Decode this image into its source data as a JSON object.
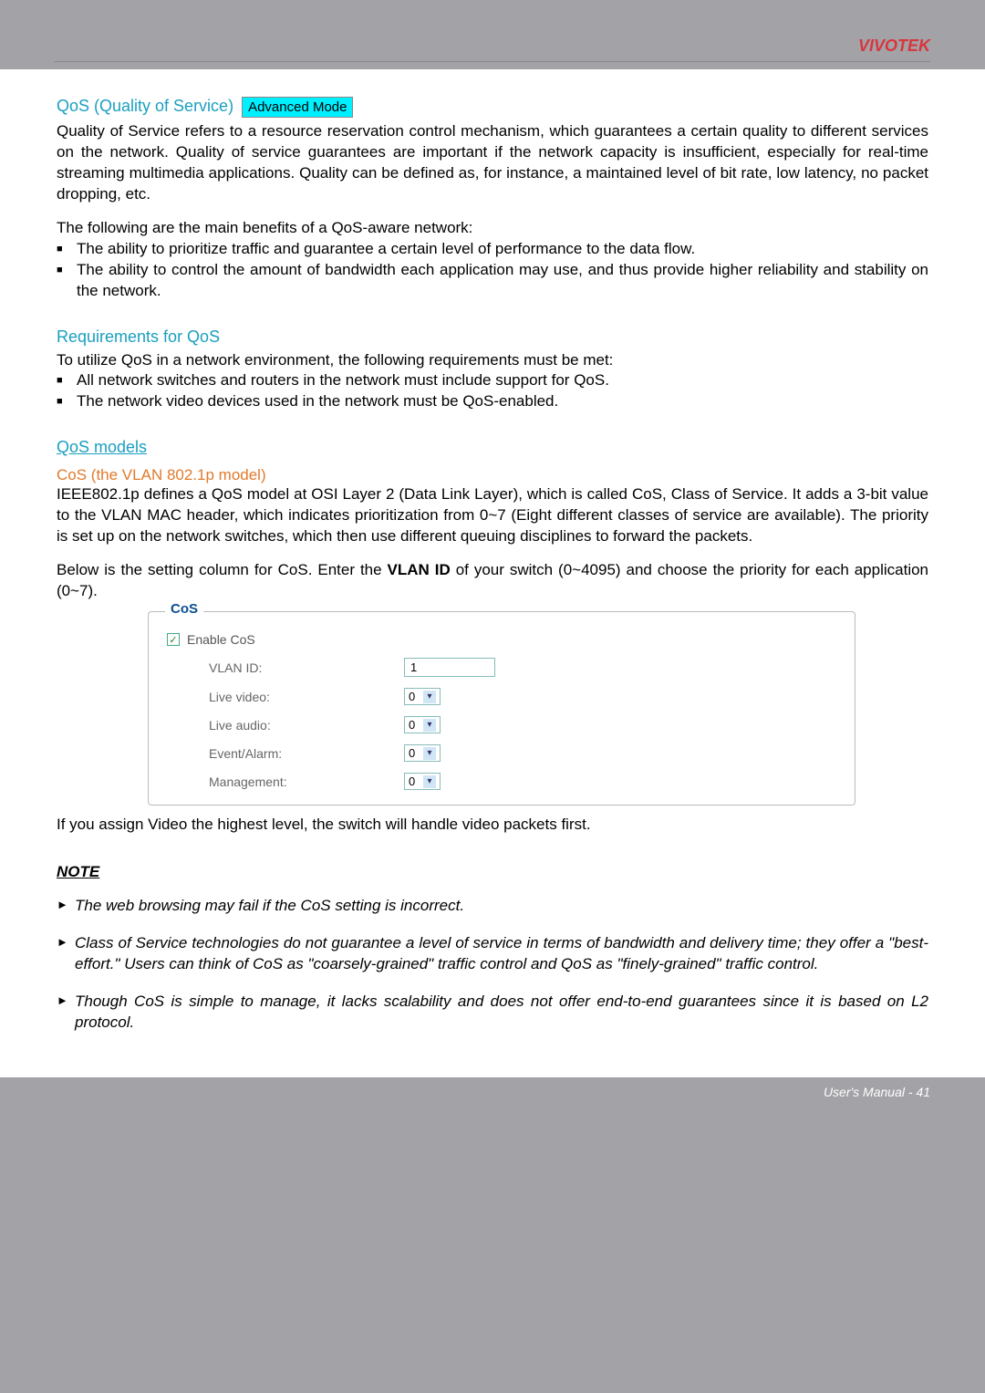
{
  "brand": "VIVOTEK",
  "qos": {
    "title": "QoS (Quality of Service)",
    "badge": "Advanced Mode",
    "intro": "Quality of Service refers to a resource reservation control mechanism, which guarantees a certain quality to different services on the network. Quality of service guarantees are important if the network capacity is insufficient, especially for real-time streaming multimedia applications. Quality can be defined as, for instance, a maintained level of bit rate, low latency, no packet dropping, etc.",
    "benefits_lead": "The following are the main benefits of a QoS-aware network:",
    "benefits": [
      "The ability to prioritize traffic and guarantee a certain level of performance to the data flow.",
      "The ability to control the amount of bandwidth each application may use, and thus provide higher reliability and stability on the network."
    ]
  },
  "req": {
    "title": "Requirements for QoS",
    "lead": "To utilize QoS in a network environment, the following requirements must be met:",
    "items": [
      "All network switches and routers in the network must include support for QoS.",
      "The network video devices used in the network must be QoS-enabled."
    ]
  },
  "models": {
    "title": "QoS models"
  },
  "cos": {
    "title": "CoS (the VLAN 802.1p model)",
    "para1": "IEEE802.1p defines a QoS model at OSI Layer 2 (Data Link Layer), which is called CoS, Class of Service. It adds a 3-bit value to the VLAN MAC header, which indicates prioritization from 0~7 (Eight different classes of service are available). The priority is set up on the network switches, which then use different queuing disciplines to forward the packets.",
    "para2_a": "Below is the setting column for CoS. Enter the ",
    "para2_bold": "VLAN ID",
    "para2_b": " of your switch (0~4095) and choose the priority for each application (0~7).",
    "box_legend": "CoS",
    "enable": "Enable CoS",
    "vlan_label": "VLAN ID:",
    "vlan_value": "1",
    "fields": [
      {
        "label": "Live video:",
        "value": "0"
      },
      {
        "label": "Live audio:",
        "value": "0"
      },
      {
        "label": "Event/Alarm:",
        "value": "0"
      },
      {
        "label": "Management:",
        "value": "0"
      }
    ],
    "after": "If you assign Video the highest level, the switch will handle video packets first."
  },
  "note": {
    "heading": "NOTE",
    "items": [
      "The web browsing may fail if the CoS setting is incorrect.",
      "Class of Service technologies do not guarantee a level of service in terms of bandwidth and delivery time; they offer a \"best-effort.\" Users can think of CoS as \"coarsely-grained\" traffic control and QoS as \"finely-grained\" traffic control.",
      "Though CoS is simple to manage, it lacks scalability and does not offer end-to-end guarantees since it is based on L2 protocol."
    ]
  },
  "footer": "User's Manual - 41"
}
